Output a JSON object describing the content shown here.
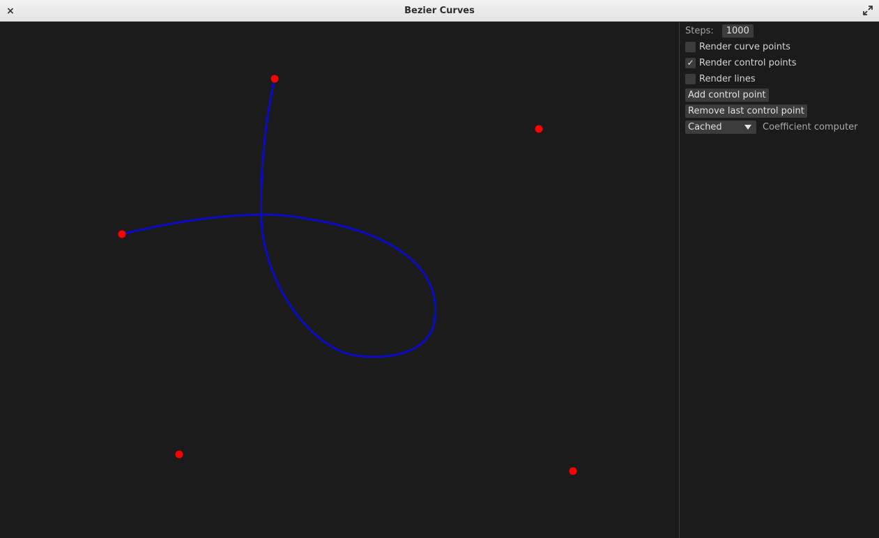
{
  "window": {
    "title": "Bezier Curves",
    "close_icon_glyph": "×"
  },
  "panel": {
    "steps_label": "Steps:",
    "steps_value": "1000",
    "checkboxes": [
      {
        "label": "Render curve points",
        "checked": false
      },
      {
        "label": "Render control points",
        "checked": true
      },
      {
        "label": "Render lines",
        "checked": false
      }
    ],
    "add_button": "Add control point",
    "remove_button": "Remove last control point",
    "coefficient_select": {
      "value": "Cached",
      "label": "Coefficient computer"
    }
  },
  "colors": {
    "curve": "#0a0ac8",
    "control_point": "#ff0000",
    "background": "#1b1b1b"
  }
}
